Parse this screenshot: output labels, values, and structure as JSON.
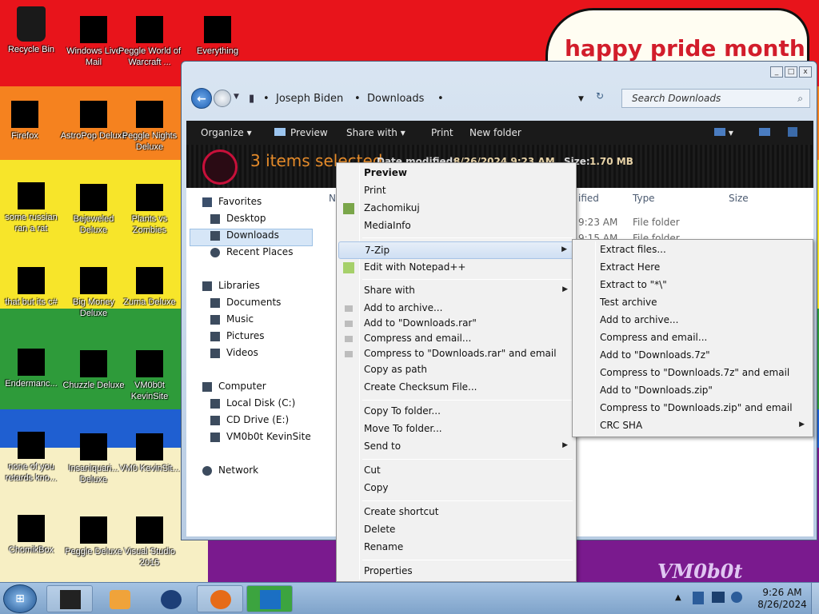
{
  "desktop": {
    "banner": "happy pride month",
    "watermark": "VM0b0t",
    "stripe_colors": [
      "#e8141b",
      "#f5821f",
      "#f7e52a",
      "#2e9b3a",
      "#1f5fd1",
      "#7a1a8e"
    ],
    "icons": [
      {
        "label": "Recycle Bin"
      },
      {
        "label": "Windows Live Mail"
      },
      {
        "label": "Peggle World of Warcraft ..."
      },
      {
        "label": "Everything"
      },
      {
        "label": "Firefox"
      },
      {
        "label": "AstroPop Deluxe"
      },
      {
        "label": "Peggle Nights Deluxe"
      },
      {
        "label": "some russian ran a rat"
      },
      {
        "label": "Bejeweled Deluxe"
      },
      {
        "label": "Plants vs Zombies"
      },
      {
        "label": "that but its c#"
      },
      {
        "label": "Big Money Deluxe"
      },
      {
        "label": "Zuma Deluxe"
      },
      {
        "label": "Endermanc..."
      },
      {
        "label": "Chuzzle Deluxe"
      },
      {
        "label": "VM0b0t KevinSite"
      },
      {
        "label": "none of you retards kno..."
      },
      {
        "label": "Insaniquari... Deluxe"
      },
      {
        "label": "VM0 KevinSit..."
      },
      {
        "label": "ChomikBox"
      },
      {
        "label": "Peggle Deluxe"
      },
      {
        "label": "Visual Studio 2015"
      }
    ]
  },
  "explorer": {
    "breadcrumb": [
      "Joseph Biden",
      "Downloads"
    ],
    "search_placeholder": "Search Downloads",
    "toolbar": [
      "Organize",
      "Preview",
      "Share with",
      "Print",
      "New folder"
    ],
    "details": {
      "title": "3 items selected",
      "date_label": "Date modified:",
      "date_value": "8/26/2024 9:23 AM",
      "size_label": "Size:",
      "size_value": "1.70 MB"
    },
    "nav": {
      "favorites": "Favorites",
      "desktop": "Desktop",
      "downloads": "Downloads",
      "recent": "Recent Places",
      "libraries": "Libraries",
      "documents": "Documents",
      "music": "Music",
      "pictures": "Pictures",
      "videos": "Videos",
      "computer": "Computer",
      "local_disk": "Local Disk (C:)",
      "cd_drive": "CD Drive (E:)",
      "vm": "VM0b0t KevinSite",
      "network": "Network"
    },
    "columns": {
      "name": "N",
      "modified": "ified",
      "type": "Type",
      "size": "Size"
    },
    "rows": [
      {
        "date": "9:23 AM",
        "type": "File folder"
      },
      {
        "date": "9:15 AM",
        "type": "File folder"
      }
    ]
  },
  "context_menu": {
    "items": [
      "Preview",
      "Print",
      "Zachomikuj",
      "MediaInfo",
      "7-Zip",
      "Edit with Notepad++",
      "Share with",
      "Add to archive...",
      "Add to \"Downloads.rar\"",
      "Compress and email...",
      "Compress to \"Downloads.rar\" and email",
      "Copy as path",
      "Create Checksum File...",
      "Copy To folder...",
      "Move To folder...",
      "Send to",
      "Cut",
      "Copy",
      "Create shortcut",
      "Delete",
      "Rename",
      "Properties"
    ]
  },
  "submenu_7zip": {
    "items": [
      "Extract files...",
      "Extract Here",
      "Extract to \"*\\\"",
      "Test archive",
      "Add to archive...",
      "Compress and email...",
      "Add to \"Downloads.7z\"",
      "Compress to \"Downloads.7z\" and email",
      "Add to \"Downloads.zip\"",
      "Compress to \"Downloads.zip\" and email",
      "CRC SHA"
    ]
  },
  "taskbar": {
    "time": "9:26 AM",
    "date": "8/26/2024"
  }
}
